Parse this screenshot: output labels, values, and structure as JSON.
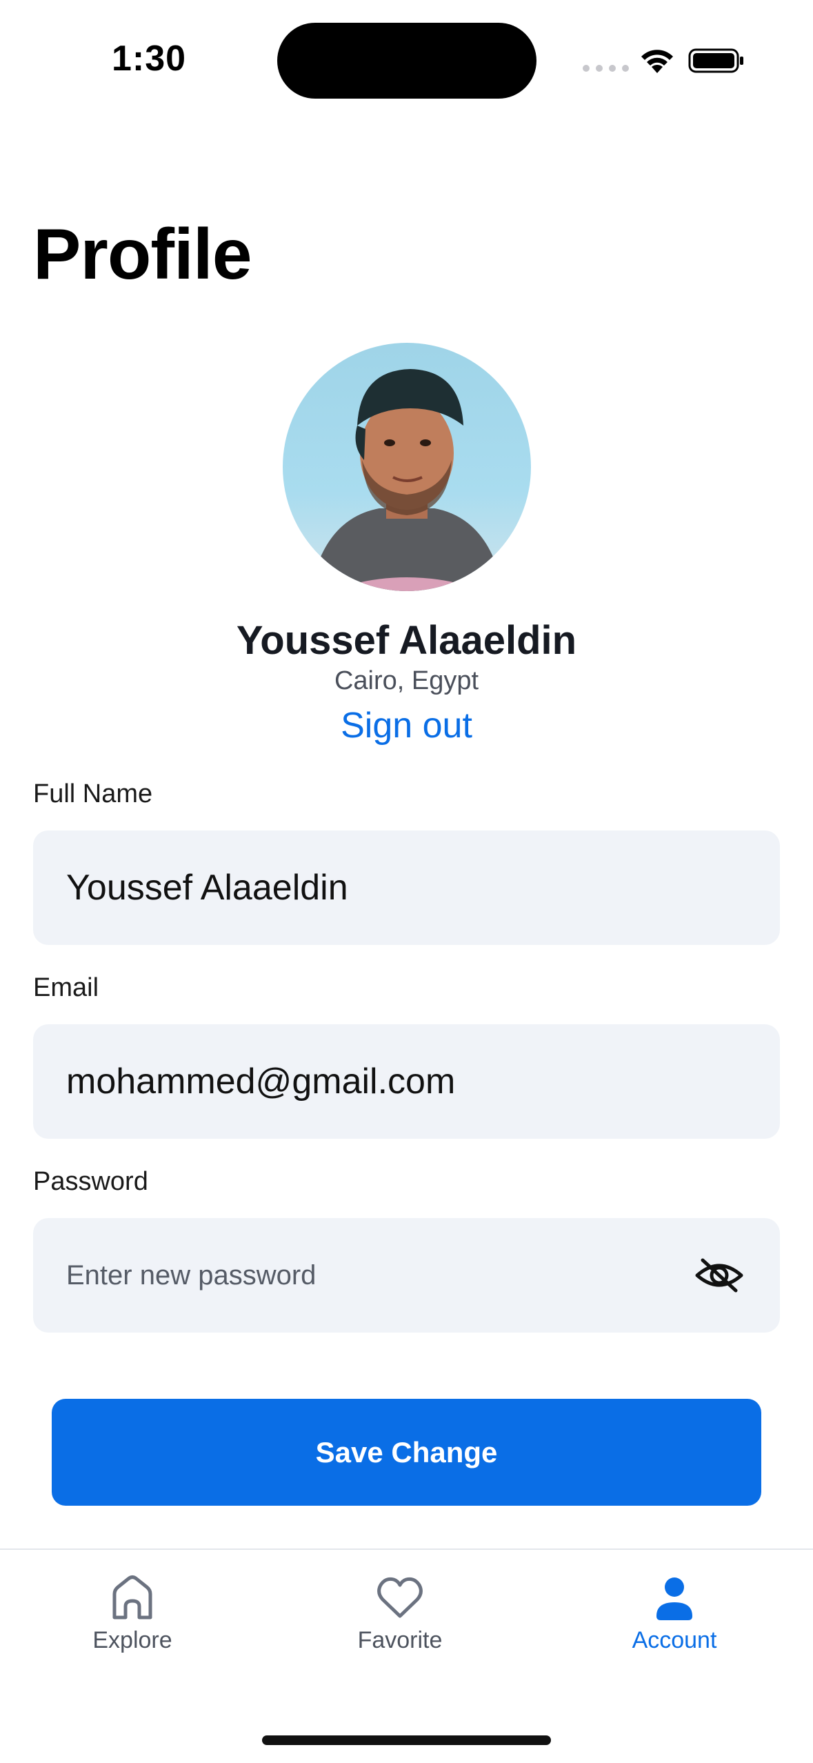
{
  "status_bar": {
    "time": "1:30"
  },
  "page": {
    "title": "Profile"
  },
  "profile": {
    "name": "Youssef Alaaeldin",
    "location": "Cairo, Egypt",
    "sign_out_label": "Sign out"
  },
  "form": {
    "full_name": {
      "label": "Full Name",
      "value": "Youssef Alaaeldin"
    },
    "email": {
      "label": "Email",
      "value": "mohammed@gmail.com"
    },
    "password": {
      "label": "Password",
      "placeholder": "Enter new password"
    },
    "save_label": "Save Change"
  },
  "tab_bar": {
    "items": [
      {
        "label": "Explore",
        "icon": "home-icon",
        "active": false
      },
      {
        "label": "Favorite",
        "icon": "heart-icon",
        "active": false
      },
      {
        "label": "Account",
        "icon": "person-icon",
        "active": true
      }
    ]
  },
  "colors": {
    "accent": "#0a6ee6",
    "field_background": "#f0f3f8",
    "inactive_tab": "#4d535e"
  }
}
